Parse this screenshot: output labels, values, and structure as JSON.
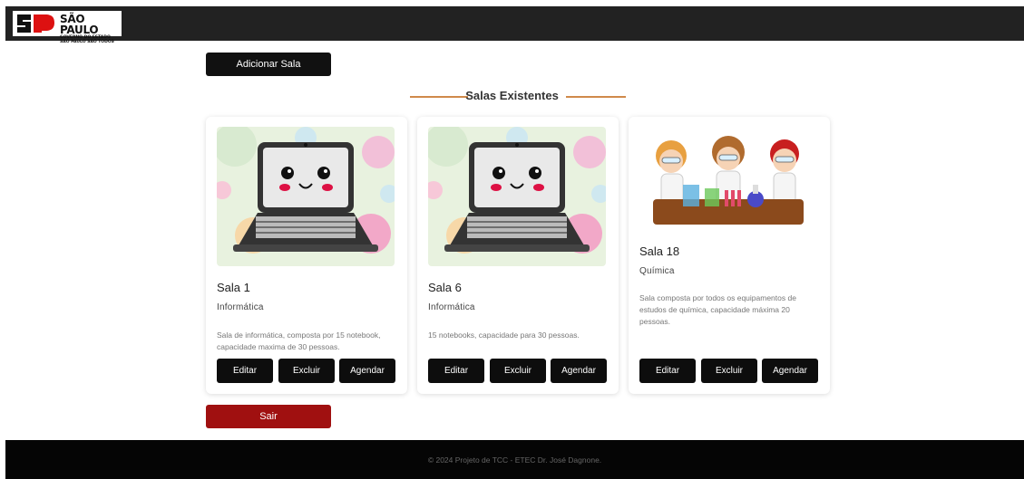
{
  "header": {
    "logo": {
      "title": "SÃO PAULO",
      "line1": "GOVERNO DO ESTADO",
      "line2": "SÃO PAULO SÃO TODOS"
    }
  },
  "actions": {
    "add_label": "Adicionar Sala",
    "exit_label": "Sair"
  },
  "section": {
    "title": "Salas Existentes"
  },
  "rooms": [
    {
      "title": "Sala 1",
      "category": "Informática",
      "description": "Sala de informática, composta por 15 notebook, capacidade maxima de 30 pessoas.",
      "image": "laptop-kawaii-image",
      "buttons": {
        "edit": "Editar",
        "delete": "Excluir",
        "schedule": "Agendar"
      }
    },
    {
      "title": "Sala 6",
      "category": "Informática",
      "description": "15 notebooks, capacidade para 30 pessoas.",
      "image": "laptop-kawaii-image",
      "buttons": {
        "edit": "Editar",
        "delete": "Excluir",
        "schedule": "Agendar"
      }
    },
    {
      "title": "Sala 18",
      "category": "Química",
      "description": "Sala composta por todos os equipamentos de estudos de química, capacidade máxima 20 pessoas.",
      "image": "chemistry-kids-image",
      "buttons": {
        "edit": "Editar",
        "delete": "Excluir",
        "schedule": "Agendar"
      }
    }
  ],
  "footer": {
    "text": "© 2024 Projeto de TCC - ETEC Dr. José Dagnone."
  },
  "colors": {
    "header_bg": "#222222",
    "accent_line": "#d08a4a",
    "exit_button": "#a01010",
    "button_bg": "#0d0d0d"
  }
}
